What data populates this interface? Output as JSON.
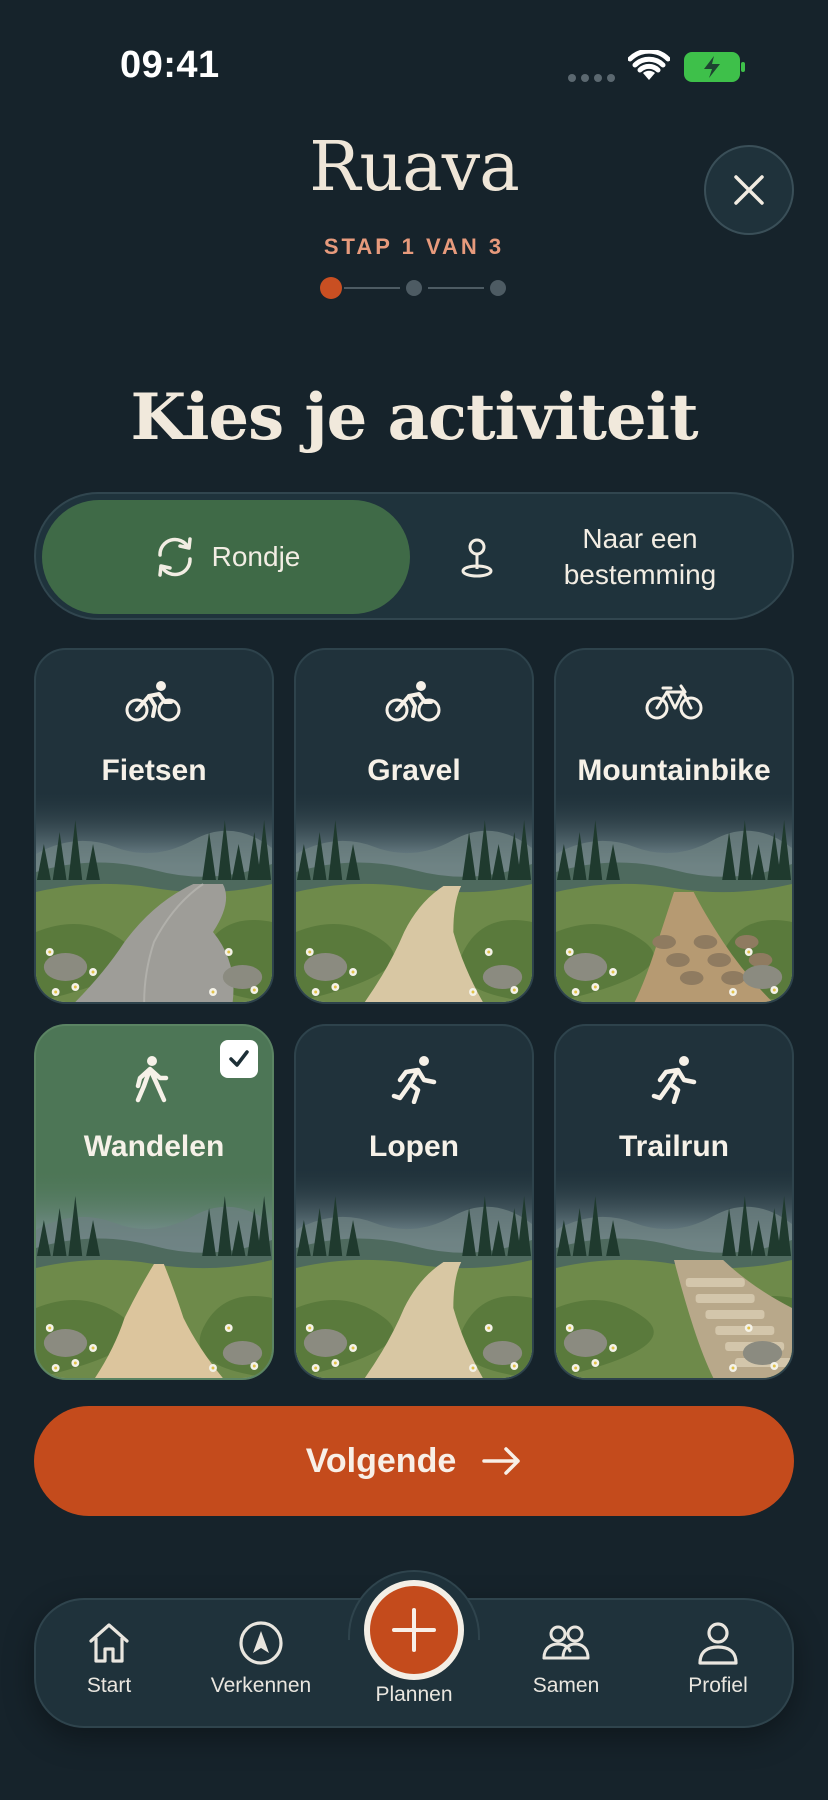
{
  "status_bar": {
    "time": "09:41"
  },
  "header": {
    "brand": "Ruava",
    "step_label": "STAP 1 VAN 3",
    "close_icon": "close-icon"
  },
  "page": {
    "title": "Kies je activiteit"
  },
  "route_type": {
    "options": [
      {
        "label": "Rondje",
        "icon": "loop-icon",
        "selected": true
      },
      {
        "label": "Naar een bestemming",
        "icon": "destination-pin-icon",
        "selected": false
      }
    ]
  },
  "activities": [
    {
      "label": "Fietsen",
      "icon": "cyclist-icon",
      "selected": false
    },
    {
      "label": "Gravel",
      "icon": "cyclist-icon",
      "selected": false
    },
    {
      "label": "Mountainbike",
      "icon": "bicycle-icon",
      "selected": false
    },
    {
      "label": "Wandelen",
      "icon": "walking-icon",
      "selected": true
    },
    {
      "label": "Lopen",
      "icon": "running-icon",
      "selected": false
    },
    {
      "label": "Trailrun",
      "icon": "running-icon",
      "selected": false
    }
  ],
  "cta": {
    "label": "Volgende"
  },
  "tabbar": {
    "items": [
      {
        "label": "Start",
        "icon": "home-icon"
      },
      {
        "label": "Verkennen",
        "icon": "compass-icon"
      },
      {
        "label": "Plannen",
        "icon": "plus-icon"
      },
      {
        "label": "Samen",
        "icon": "people-icon"
      },
      {
        "label": "Profiel",
        "icon": "person-icon"
      }
    ]
  },
  "colors": {
    "background": "#16232b",
    "accent": "#c44b1c",
    "selected_green": "#3f6a47",
    "step_label": "#e79a7c"
  }
}
